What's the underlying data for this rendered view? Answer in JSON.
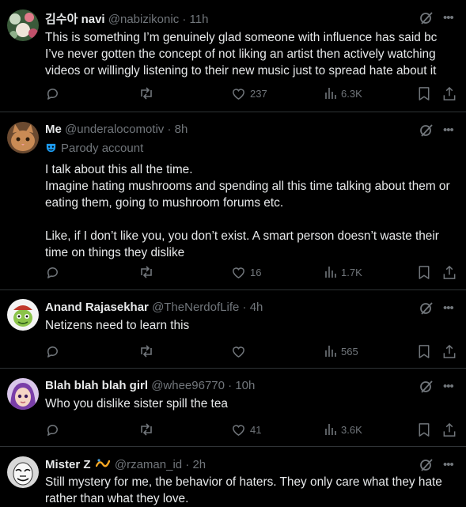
{
  "tweets": [
    {
      "name": "김수아 navi",
      "handle": "@nabizikonic",
      "time": "11h",
      "text": "This is something I’m genuinely glad someone with influence has said bc\nI’ve never gotten the concept of not liking an artist then actively watching\nvideos or willingly listening to their new music just to spread hate about it",
      "likes": "237",
      "views": "6.3K",
      "avatar_icon": "avatar-flowers-icon"
    },
    {
      "name": "Me",
      "handle": "@underalocomotiv",
      "time": "8h",
      "badge": "Parody account",
      "text": "I talk about this all the time.\nImagine hating mushrooms and spending all this time talking about them or\neating them, going to mushroom forums etc.\n\nLike, if I don’t like you, you don’t exist. A smart person doesn’t waste their\ntime on things they dislike",
      "likes": "16",
      "views": "1.7K",
      "avatar_icon": "avatar-cat-icon"
    },
    {
      "name": "Anand Rajasekhar",
      "handle": "@TheNerdofLife",
      "time": "4h",
      "text": "Netizens need to learn this",
      "likes": "",
      "views": "565",
      "avatar_icon": "avatar-cartoon-icon"
    },
    {
      "name": "Blah blah blah girl",
      "handle": "@whee96770",
      "time": "10h",
      "text": "Who you dislike sister spill the tea",
      "likes": "41",
      "views": "3.6K",
      "avatar_icon": "avatar-anime-icon"
    },
    {
      "name": "Mister Z",
      "handle": "@rzaman_id",
      "time": "2h",
      "text": "Still mystery for me, the behavior of haters. They only care what they hate\nrather than what they love.",
      "avatar_icon": "avatar-mask-icon"
    }
  ],
  "separator": "·",
  "more_glyph": "•••"
}
